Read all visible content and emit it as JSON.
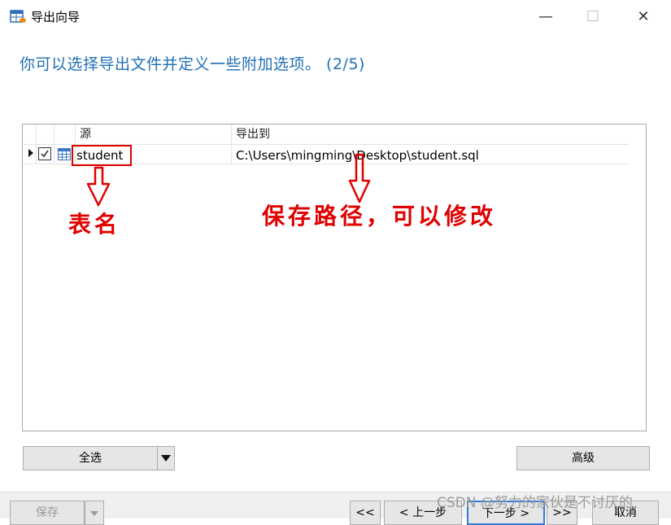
{
  "window": {
    "title": "导出向导",
    "min_glyph": "—",
    "max_glyph": "☐",
    "close_glyph": "✕"
  },
  "heading": "你可以选择导出文件并定义一些附加选项。 (2/5)",
  "table": {
    "columns": [
      "源",
      "导出到"
    ],
    "rows": [
      {
        "checked": true,
        "source": "student",
        "destination": "C:\\Users\\mingming\\Desktop\\student.sql"
      }
    ]
  },
  "annotations": {
    "table_name": "表名",
    "save_path": "保存路径，可以修改"
  },
  "buttons": {
    "select_all": "全选",
    "advanced": "高级",
    "save": "保存",
    "first": "<<",
    "prev": "< 上一步",
    "next": "下一步 >",
    "last": ">>",
    "cancel": "取消"
  },
  "watermark": "CSDN @努力的家伙是不讨厌的",
  "colors": {
    "heading": "#1f6fb5",
    "annotation_red": "#e00000"
  }
}
